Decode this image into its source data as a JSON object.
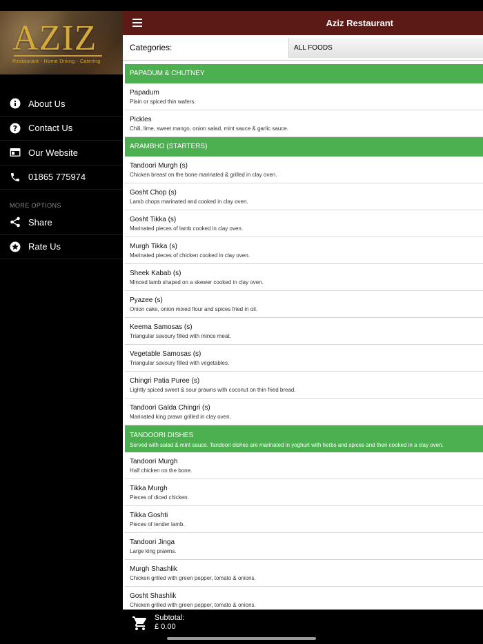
{
  "app": {
    "title": "Aziz Restaurant",
    "brand_color": "#5b1a16",
    "section_color": "#4cb050"
  },
  "logo": {
    "name": "AZIZ",
    "tagline": "Restaurant - Home Dining - Catering"
  },
  "sidebar": {
    "items": [
      {
        "label": "About Us",
        "icon": "info-icon"
      },
      {
        "label": "Contact Us",
        "icon": "help-icon"
      },
      {
        "label": "Our Website",
        "icon": "browser-icon"
      },
      {
        "label": "01865 775974",
        "icon": "phone-icon"
      }
    ],
    "more_options_label": "MORE OPTIONS",
    "more_items": [
      {
        "label": "Share",
        "icon": "share-icon"
      },
      {
        "label": "Rate Us",
        "icon": "star-icon"
      }
    ]
  },
  "categories": {
    "label": "Categories:",
    "selected": "ALL FOODS"
  },
  "sections": [
    {
      "title": "PAPADUM & CHUTNEY",
      "description": "",
      "items": [
        {
          "name": "Papadum",
          "desc": "Plain or spiced thin wafers."
        },
        {
          "name": "Pickles",
          "desc": "Chili, lime, sweet mango, onion salad, mint sauce & garlic sauce."
        }
      ]
    },
    {
      "title": "ARAMBHO (STARTERS)",
      "description": "",
      "items": [
        {
          "name": "Tandoori Murgh (s)",
          "desc": "Chicken breast on the bone marinated & grilled in clay oven."
        },
        {
          "name": "Gosht Chop (s)",
          "desc": "Lamb chops marinated and cooked in clay oven."
        },
        {
          "name": "Gosht Tikka (s)",
          "desc": "Marinated pieces of lamb cooked in clay oven."
        },
        {
          "name": "Murgh Tikka (s)",
          "desc": "Marinated pieces of chicken cooked in clay oven."
        },
        {
          "name": "Sheek Kabab (s)",
          "desc": "Minced lamb shaped on a skewer cooked in clay oven."
        },
        {
          "name": "Pyazee (s)",
          "desc": "Onion cake, onion mixed flour and spices fried in oil."
        },
        {
          "name": "Keema Samosas (s)",
          "desc": "Triangular savoury filled with mince meat."
        },
        {
          "name": "Vegetable Samosas (s)",
          "desc": "Triangular savoury filled with vegetables."
        },
        {
          "name": "Chingri Patia Puree (s)",
          "desc": "Lightly spiced sweet & sour prawns with coconut on thin fried bread."
        },
        {
          "name": "Tandoori Galda Chingri (s)",
          "desc": "Marinated king prawn grilled in clay oven."
        }
      ]
    },
    {
      "title": "TANDOORI DISHES",
      "description": "Served with salad & mint sauce. Tandoori dishes are marinated in yoghurt with herbs and spices and then cooked in a clay oven.",
      "items": [
        {
          "name": "Tandoori Murgh",
          "desc": "Half chicken on the bone."
        },
        {
          "name": "Tikka Murgh",
          "desc": "Pieces of diced chicken."
        },
        {
          "name": "Tikka Goshti",
          "desc": "Pieces of tender lamb."
        },
        {
          "name": "Tandoori Jinga",
          "desc": "Large king prawns."
        },
        {
          "name": "Murgh Shashlik",
          "desc": "Chicken grilled with green pepper, tomato & onions."
        },
        {
          "name": "Gosht Shashlik",
          "desc": "Chicken grilled with green pepper, tomato & onions."
        }
      ]
    }
  ],
  "cart": {
    "subtotal_label": "Subtotal:",
    "subtotal_value": "£ 0.00",
    "icon": "cart-icon"
  }
}
